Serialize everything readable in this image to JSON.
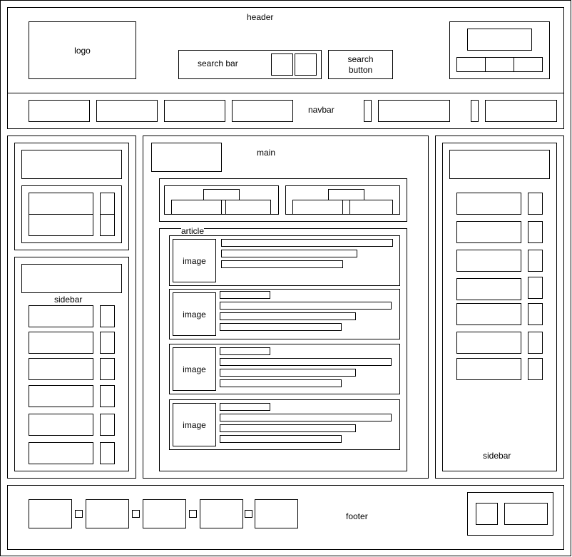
{
  "header": {
    "label": "header",
    "logo": "logo",
    "search_bar": "search bar",
    "search_button": "search\nbutton"
  },
  "navbar": {
    "label": "navbar"
  },
  "main": {
    "label": "main",
    "article_label": "article",
    "articles": [
      {
        "image": "image"
      },
      {
        "image": "image"
      },
      {
        "image": "image"
      },
      {
        "image": "image"
      }
    ]
  },
  "left_sidebar": {
    "label": "sidebar"
  },
  "right_sidebar": {
    "label": "sidebar"
  },
  "footer": {
    "label": "footer"
  }
}
